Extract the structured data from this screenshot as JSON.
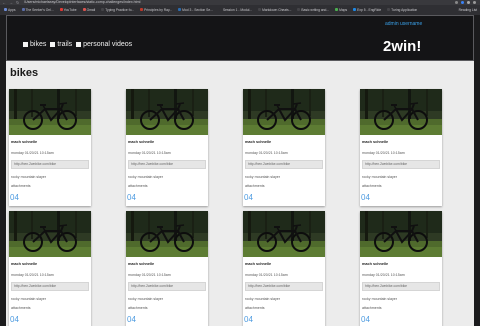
{
  "browser": {
    "url": "/Users/michaelseay/DevelopInterfaces/static-comp-challenges/index.html",
    "bookmarks": [
      {
        "label": "Apps",
        "color": "#6b8bd6"
      },
      {
        "label": "The Seeker's Onl...",
        "color": "#5c6ea8"
      },
      {
        "label": "YouTube",
        "color": "#e53935"
      },
      {
        "label": "Gmail",
        "color": "#d9534f"
      },
      {
        "label": "Typing Practice fo...",
        "color": "#444448"
      },
      {
        "label": "Principles by Ray...",
        "color": "#c0392b"
      },
      {
        "label": "Mod 3 - Section Se...",
        "color": "#2b6cb0"
      },
      {
        "label": "Session 1 - Modul...",
        "color": "#2f2f33"
      },
      {
        "label": "Markdown Cheats...",
        "color": "#444448"
      },
      {
        "label": "Basic writing and...",
        "color": "#444448"
      },
      {
        "label": "Maps",
        "color": "#4caf50"
      },
      {
        "label": "Exp 5 - EngRide",
        "color": "#1e88e5"
      },
      {
        "label": "Turing Application",
        "color": "#444448"
      }
    ],
    "reading_list": "Reading List"
  },
  "header": {
    "nav": [
      "bikes",
      "trails",
      "personal videos"
    ],
    "account": "admin username",
    "logo": "2win!"
  },
  "section_title": "bikes",
  "card": {
    "title": "mach schnelle",
    "date": "monday 01/20/21  10:15am",
    "link": "http://ben.2wnbike.com/bike",
    "location": "rocky mountain slayer",
    "attachments": "attachments",
    "number": "04"
  }
}
